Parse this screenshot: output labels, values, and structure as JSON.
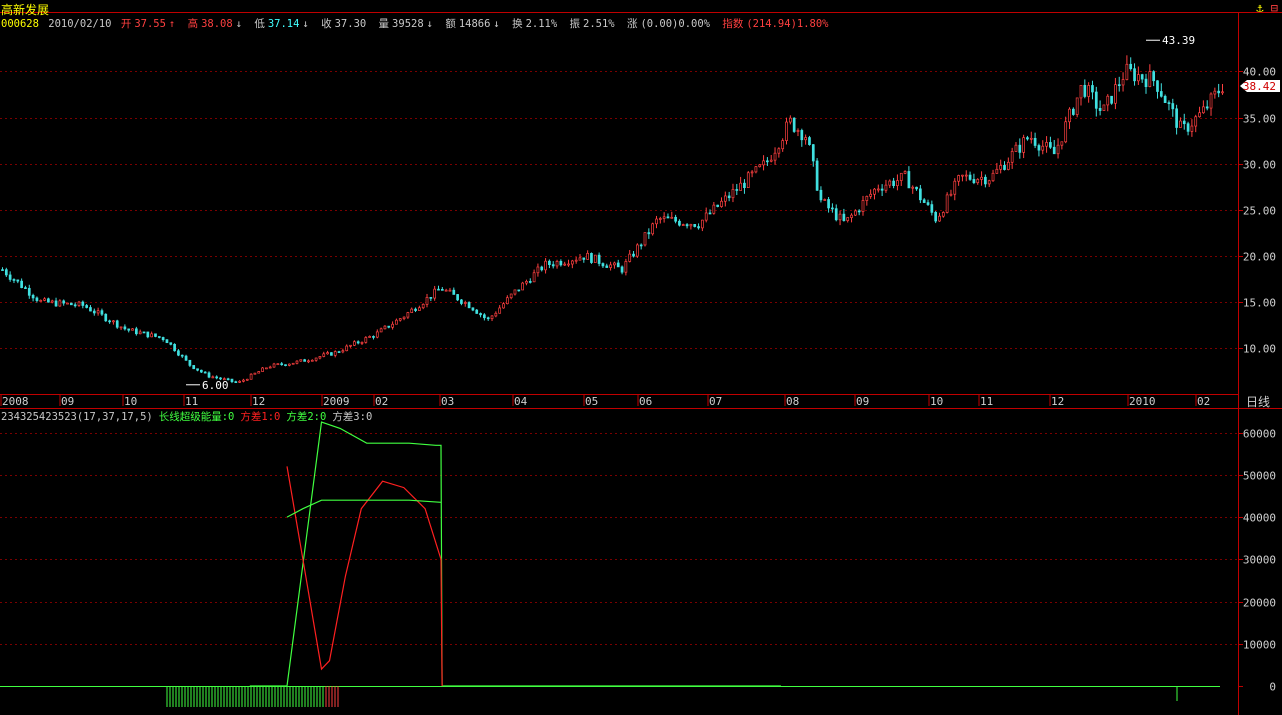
{
  "stock": {
    "name": "高新发展"
  },
  "info": {
    "code": "000628",
    "date": "2010/02/10",
    "open_label": "开",
    "open": "37.55",
    "open_arrow": "↑",
    "high_label": "高",
    "high": "38.08",
    "high_arrow": "↓",
    "low_label": "低",
    "low": "37.14",
    "low_arrow": "↓",
    "close_label": "收",
    "close": "37.30",
    "volume_label": "量",
    "volume": "39528",
    "volume_arrow": "↓",
    "amount_label": "额",
    "amount": "14866",
    "amount_arrow": "↓",
    "turnover_label": "换",
    "turnover": "2.11%",
    "amplitude_label": "振",
    "amplitude": "2.51%",
    "change_label": "涨",
    "change": "(0.00)0.00%",
    "index_label": "指数",
    "index": "(214.94)1.80%"
  },
  "indicator": {
    "name": "234325423523(17,37,17,5)",
    "series_labels": [
      "长线超级能量:0",
      "方差1:0",
      "方差2:0",
      "方差3:0"
    ]
  },
  "period_label": "日线",
  "colors": {
    "up": "#ff4040",
    "down": "#40e0e0",
    "grid": "#7a0000",
    "axis": "#c00000",
    "energy": "#40ff40",
    "var1": "#ff2020",
    "var2": "#40ff40",
    "var3": "#c0c0c0"
  },
  "chart_data": [
    {
      "type": "candlestick",
      "price_axis": {
        "ylim": [
          5,
          44.5
        ],
        "ticks": [
          "10.00",
          "15.00",
          "20.00",
          "25.00",
          "30.00",
          "35.00",
          "40.00"
        ],
        "current": "38.42"
      },
      "x_labels": [
        "2008",
        "09",
        "10",
        "11",
        "12",
        "2009",
        "02",
        "03",
        "04",
        "05",
        "06",
        "07",
        "08",
        "09",
        "10",
        "11",
        "12",
        "2010",
        "02"
      ],
      "annotations": {
        "max": "43.39",
        "min": "6.00"
      },
      "anchors": [
        [
          "2008-08-01",
          18.5
        ],
        [
          "2008-08-20",
          15.0
        ],
        [
          "2008-09-10",
          14.6
        ],
        [
          "2008-10-01",
          12.0
        ],
        [
          "2008-10-20",
          11.0
        ],
        [
          "2008-11-01",
          8.2
        ],
        [
          "2008-11-10",
          7.0
        ],
        [
          "2008-11-25",
          6.2
        ],
        [
          "2008-12-10",
          8.0
        ],
        [
          "2008-12-25",
          8.5
        ],
        [
          "2009-01-12",
          9.5
        ],
        [
          "2009-02-01",
          11.5
        ],
        [
          "2009-02-15",
          13.5
        ],
        [
          "2009-03-05",
          16.5
        ],
        [
          "2009-03-20",
          14.5
        ],
        [
          "2009-03-28",
          13.0
        ],
        [
          "2009-04-10",
          16.0
        ],
        [
          "2009-04-25",
          19.0
        ],
        [
          "2009-05-15",
          20.0
        ],
        [
          "2009-06-02",
          18.5
        ],
        [
          "2009-06-20",
          24.0
        ],
        [
          "2009-07-10",
          23.5
        ],
        [
          "2009-07-25",
          26.5
        ],
        [
          "2009-08-12",
          30.0
        ],
        [
          "2009-08-24",
          34.5
        ],
        [
          "2009-09-01",
          33.0
        ],
        [
          "2009-09-08",
          26.0
        ],
        [
          "2009-09-20",
          23.5
        ],
        [
          "2009-10-06",
          27.5
        ],
        [
          "2009-10-20",
          28.5
        ],
        [
          "2009-11-04",
          24.0
        ],
        [
          "2009-11-16",
          28.5
        ],
        [
          "2009-12-01",
          28.5
        ],
        [
          "2009-12-20",
          33.0
        ],
        [
          "2010-01-01",
          31.0
        ],
        [
          "2010-01-15",
          38.5
        ],
        [
          "2010-01-25",
          35.5
        ],
        [
          "2010-02-05",
          40.0
        ],
        [
          "2010-02-20",
          39.0
        ],
        [
          "2010-03-05",
          33.5
        ],
        [
          "2010-03-15",
          35.5
        ],
        [
          "2010-03-25",
          38.5
        ]
      ]
    },
    {
      "type": "line",
      "yaxis": {
        "ylim": [
          0,
          63000
        ],
        "ticks": [
          "0",
          "10000",
          "20000",
          "30000",
          "40000",
          "50000",
          "60000"
        ]
      },
      "series": [
        {
          "name": "长线超级能量",
          "points": [
            [
              0,
              0
            ],
            [
              0.07,
              0
            ],
            [
              0.135,
              62500
            ],
            [
              0.17,
              61000
            ],
            [
              0.22,
              57500
            ],
            [
              0.3,
              57500
            ],
            [
              0.35,
              57000
            ],
            [
              0.36,
              57000
            ],
            [
              0.362,
              0
            ],
            [
              1.0,
              0
            ]
          ]
        },
        {
          "name": "方差1",
          "points": [
            [
              0.07,
              52000
            ],
            [
              0.1,
              30000
            ],
            [
              0.135,
              4000
            ],
            [
              0.15,
              6000
            ],
            [
              0.18,
              26000
            ],
            [
              0.21,
              42000
            ],
            [
              0.25,
              48500
            ],
            [
              0.29,
              47000
            ],
            [
              0.33,
              42000
            ],
            [
              0.36,
              30000
            ],
            [
              0.362,
              0
            ]
          ]
        },
        {
          "name": "方差2",
          "points": [
            [
              0.07,
              40000
            ],
            [
              0.1,
              42000
            ],
            [
              0.135,
              44000
            ],
            [
              0.3,
              44000
            ],
            [
              0.36,
              43500
            ]
          ]
        },
        {
          "name": "方差3",
          "points": [
            [
              0.071,
              -4000
            ],
            [
              0.135,
              -4000
            ]
          ]
        }
      ]
    }
  ]
}
